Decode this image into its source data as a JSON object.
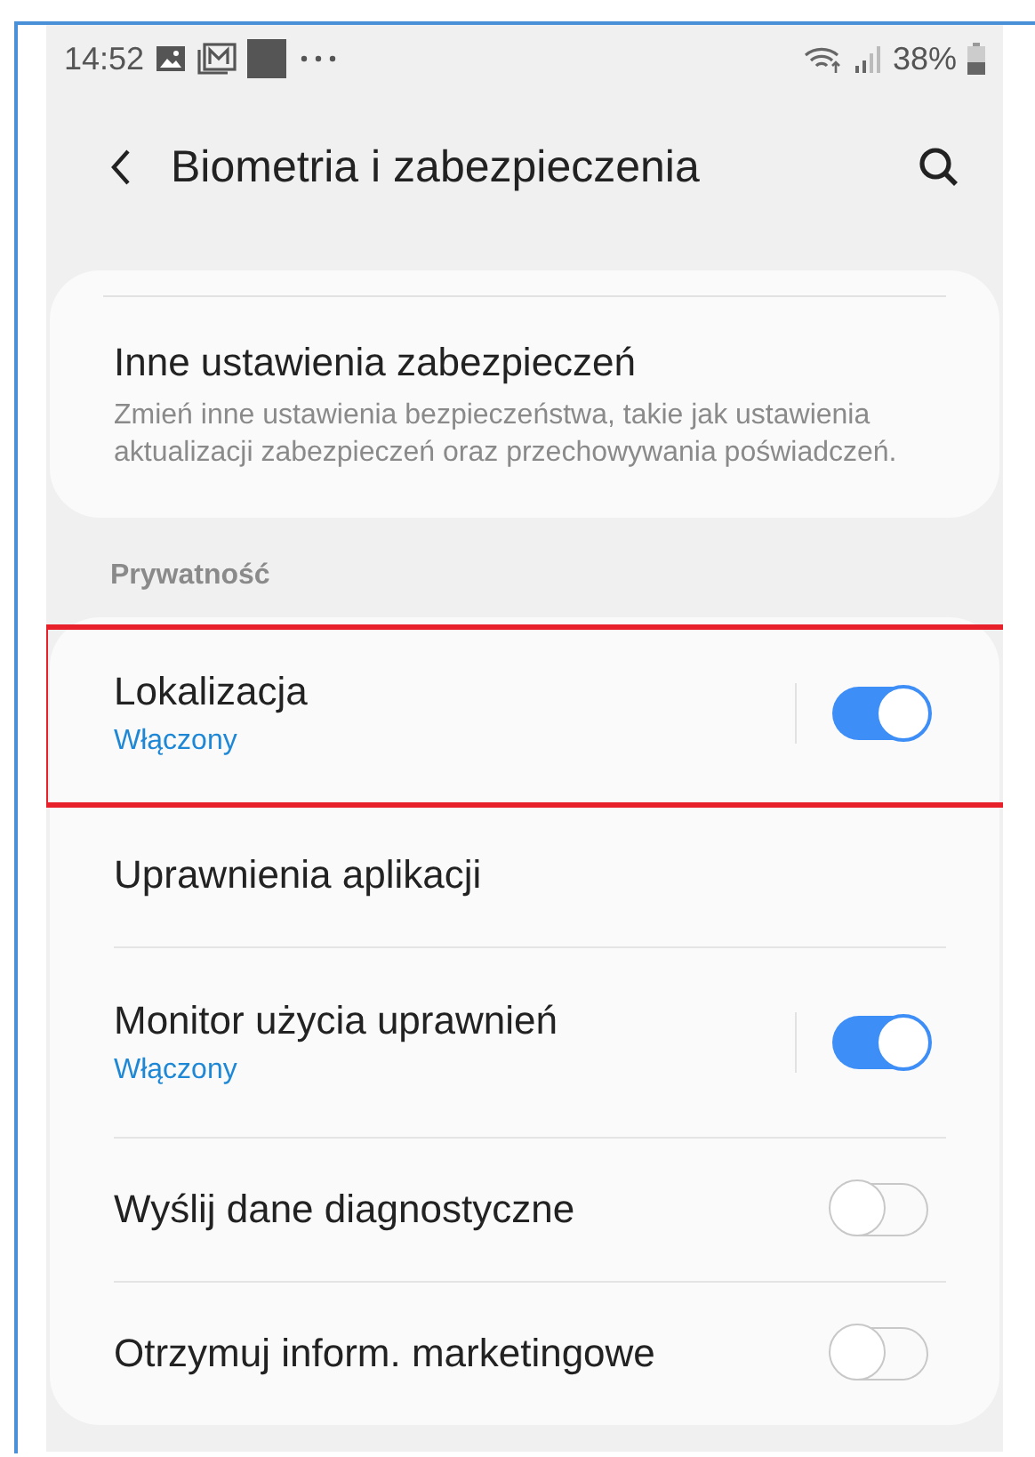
{
  "status_bar": {
    "time": "14:52",
    "battery": "38%"
  },
  "header": {
    "title": "Biometria i zabezpieczenia"
  },
  "security_card": {
    "title": "Inne ustawienia zabezpieczeń",
    "description": "Zmień inne ustawienia bezpieczeństwa, takie jak ustawienia aktualizacji zabezpieczeń oraz przechowywania poświadczeń."
  },
  "privacy": {
    "label": "Prywatność",
    "items": [
      {
        "kind": "toggle",
        "title": "Lokalizacja",
        "status": "Włączony",
        "on": true,
        "highlighted": true
      },
      {
        "kind": "link",
        "title": "Uprawnienia aplikacji",
        "highlighted": false
      },
      {
        "kind": "toggle",
        "title": "Monitor użycia uprawnień",
        "status": "Włączony",
        "on": true,
        "highlighted": false
      },
      {
        "kind": "toggle",
        "title": "Wyślij dane diagnostyczne",
        "on": false,
        "highlighted": false
      },
      {
        "kind": "toggle",
        "title": "Otrzymuj inform. marketingowe",
        "on": false,
        "highlighted": false
      }
    ]
  }
}
